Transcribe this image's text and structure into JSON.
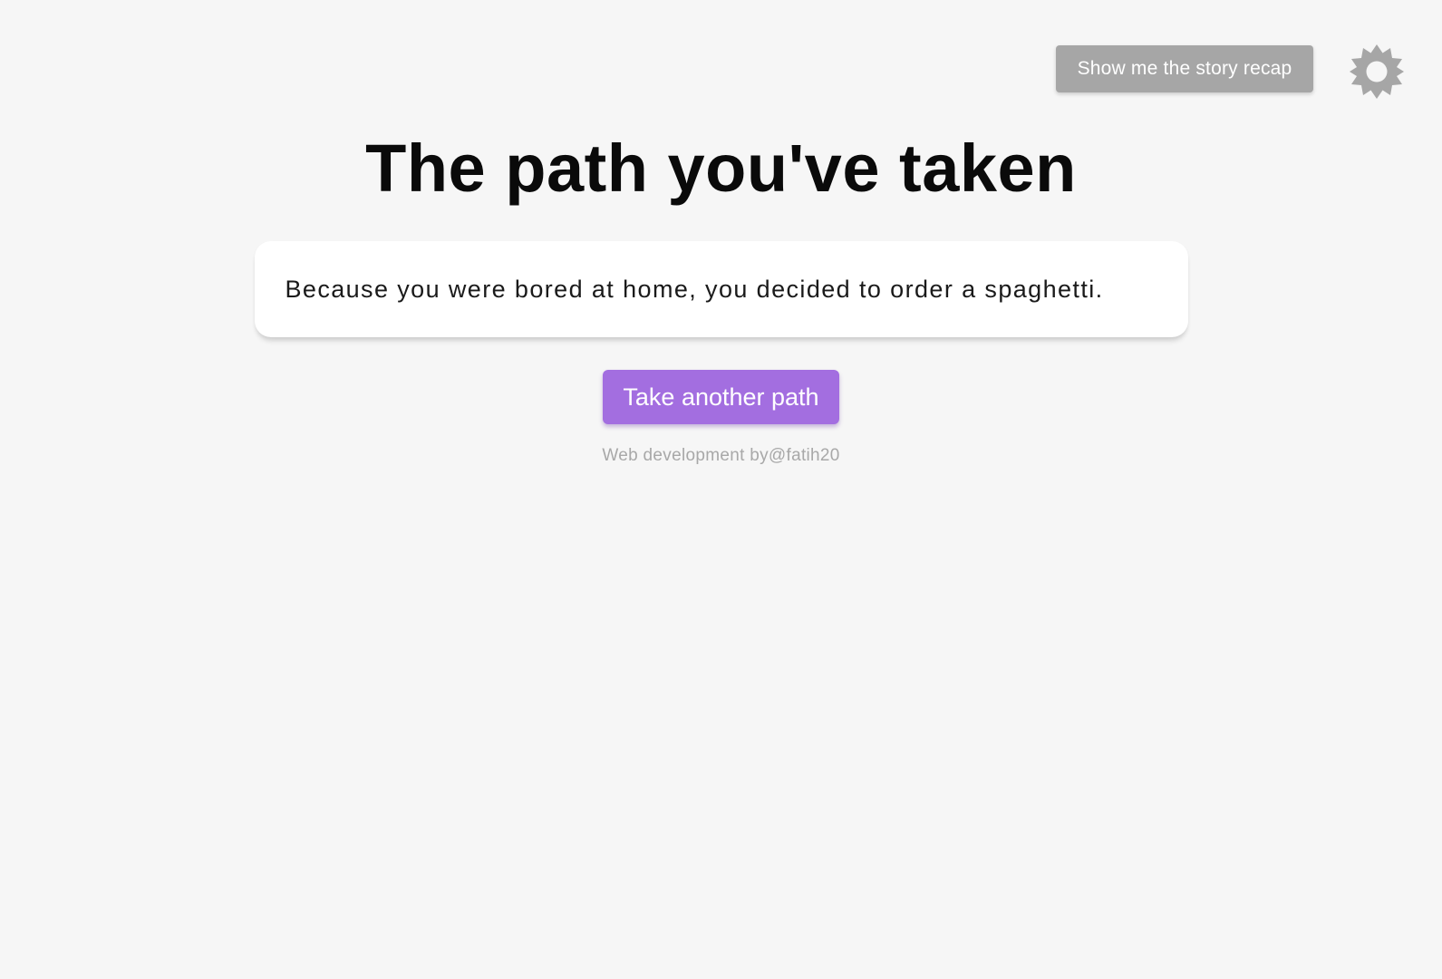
{
  "header": {
    "recap_button_label": "Show me the story recap",
    "theme_toggle_icon": "sun-icon"
  },
  "main": {
    "title": "The path you've taken",
    "story_text": "Because you were bored at home, you decided to order a spaghetti.",
    "take_another_path_label": "Take another path"
  },
  "footer": {
    "credit_prefix": "Web development by",
    "credit_handle": "@fatih20"
  },
  "colors": {
    "background": "#f6f6f6",
    "recap_button_bg": "#a6a6a6",
    "primary_button_bg": "#a36ee0",
    "icon_gray": "#a6a6a6",
    "credit_text": "#a8a8a8"
  }
}
